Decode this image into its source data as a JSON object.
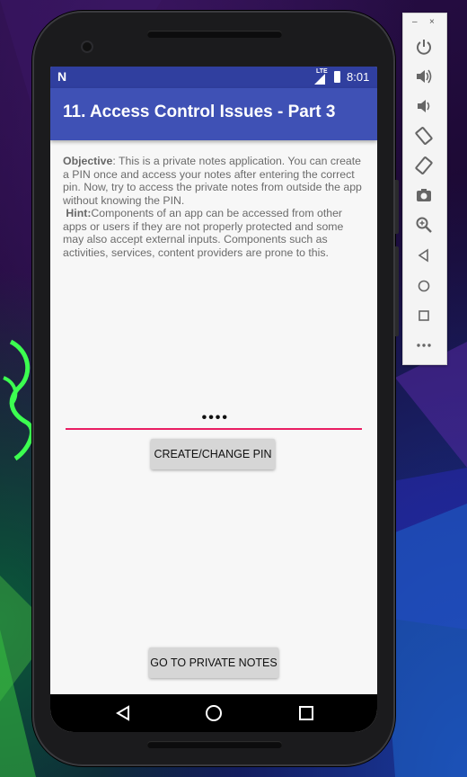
{
  "status_bar": {
    "notification_icon": "N",
    "network_label": "LTE",
    "time": "8:01"
  },
  "app": {
    "title": "11. Access Control Issues - Part 3",
    "objective_label": "Objective",
    "objective_text": ": This is a private notes application. You can create a PIN once and access your notes after entering the correct pin. Now, try to access the private notes from outside the app without knowing the PIN.",
    "hint_label": "Hint:",
    "hint_text": "Components of an app can be accessed from other apps or users if they are not properly protected and some may also accept external inputs. Components such as activities, services, content providers are prone to this.",
    "pin_value": "••••",
    "create_pin_button": "CREATE/CHANGE PIN",
    "go_to_notes_button": "GO TO PRIVATE NOTES"
  },
  "emulator_toolbar": {
    "minimize": "–",
    "close": "×",
    "tools": [
      "power-icon",
      "volume-up-icon",
      "volume-down-icon",
      "rotate-left-icon",
      "rotate-right-icon",
      "camera-icon",
      "zoom-icon",
      "back-icon",
      "home-icon",
      "overview-icon",
      "more-icon"
    ]
  },
  "colors": {
    "status_bar": "#303f9f",
    "app_bar": "#3f51b5",
    "accent": "#e91e63",
    "button": "#d6d6d6"
  }
}
